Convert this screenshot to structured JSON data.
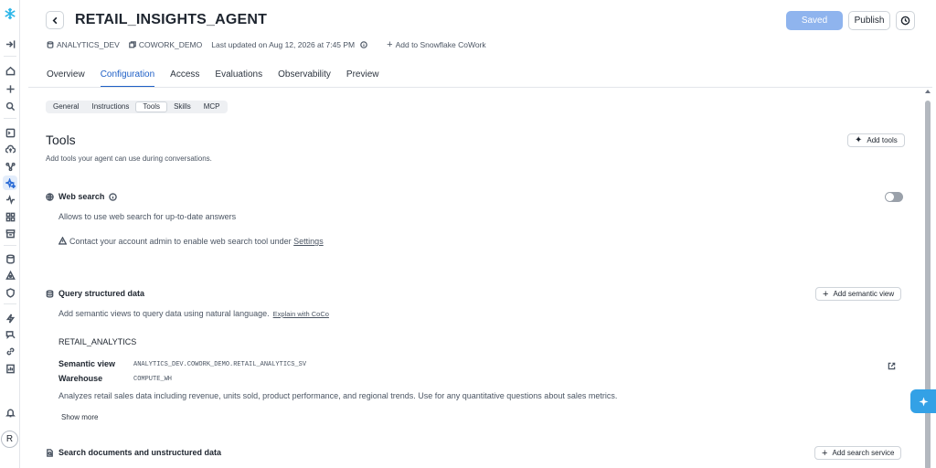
{
  "agent": {
    "title": "RETAIL_INSIGHTS_AGENT",
    "database": "ANALYTICS_DEV",
    "schema": "COWORK_DEMO",
    "last_updated": "Last updated on Aug 12, 2026 at 7:45 PM",
    "add_cowork_label": "Add to Snowflake CoWork"
  },
  "header_buttons": {
    "saved": "Saved",
    "publish": "Publish"
  },
  "tabs": [
    {
      "label": "Overview",
      "active": false
    },
    {
      "label": "Configuration",
      "active": true
    },
    {
      "label": "Access",
      "active": false
    },
    {
      "label": "Evaluations",
      "active": false
    },
    {
      "label": "Observability",
      "active": false
    },
    {
      "label": "Preview",
      "active": false
    }
  ],
  "subtabs": [
    {
      "label": "General",
      "active": false
    },
    {
      "label": "Instructions",
      "active": false
    },
    {
      "label": "Tools",
      "active": true
    },
    {
      "label": "Skills",
      "active": false
    },
    {
      "label": "MCP",
      "active": false
    }
  ],
  "tools_section": {
    "title": "Tools",
    "subtitle": "Add tools your agent can use during conversations.",
    "add_button": "Add tools"
  },
  "web_search": {
    "title": "Web search",
    "description": "Allows to use web search for up-to-date answers",
    "warning_prefix": "Contact your account admin to enable web search tool under",
    "warning_link": "Settings",
    "enabled": false
  },
  "structured": {
    "title": "Query structured data",
    "description": "Add semantic views to query data using natural language.",
    "explain_link": "Explain with CoCo",
    "add_button": "Add semantic view",
    "item": {
      "name": "RETAIL_ANALYTICS",
      "semantic_view_label": "Semantic view",
      "semantic_view_value": "ANALYTICS_DEV.COWORK_DEMO.RETAIL_ANALYTICS_SV",
      "warehouse_label": "Warehouse",
      "warehouse_value": "COMPUTE_WH",
      "description": "Analyzes retail sales data including revenue, units sold, product performance, and regional trends. Use for any quantitative questions about sales metrics.",
      "show_more": "Show more"
    }
  },
  "unstructured": {
    "title": "Search documents and unstructured data",
    "add_button": "Add search service"
  },
  "user": {
    "initial": "R"
  },
  "colors": {
    "accent": "#1e5fc6",
    "saved_button": "#8fb4ee",
    "fab": "#33a1e6",
    "logo": "#29b5e8"
  }
}
